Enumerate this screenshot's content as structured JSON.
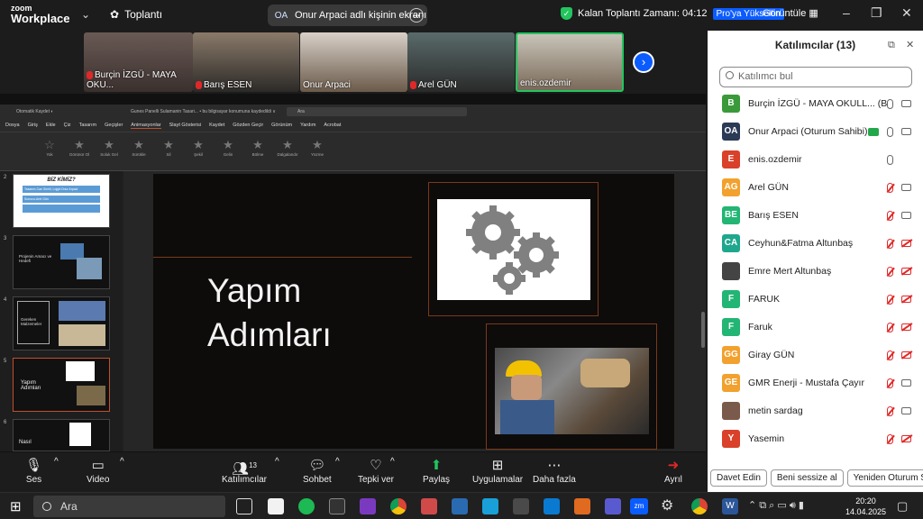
{
  "app": {
    "logo_line1": "zoom",
    "logo_line2": "Workplace",
    "meeting_label": "Toplantı",
    "share_badge": "OA",
    "share_text": "Onur Arpaci adlı kişinin ekranı",
    "timer_text": "Kalan Toplantı Zamanı: 04:12",
    "upgrade_label": "Pro'ya Yükseltin",
    "view_label": "Görüntüle"
  },
  "tiles": [
    {
      "name": "Burçin İZGÜ - MAYA OKU..."
    },
    {
      "name": "Barış ESEN"
    },
    {
      "name": "Onur Arpaci"
    },
    {
      "name": "Arel GÜN"
    },
    {
      "name": "enis.ozdemir"
    }
  ],
  "ppt": {
    "doc_title": "Gunes Panelli Sulamanin Tasari... • bu bilgisayar konumuna kaydedildi ∨",
    "search": "Ara",
    "menu": [
      "Dosya",
      "Giriş",
      "Ekle",
      "Çiz",
      "Tasarım",
      "Geçişler",
      "Animasyonlar",
      "Slayt Gösterisi",
      "Kaydet",
      "Gözden Geçir",
      "Görünüm",
      "Yardım",
      "Acrobat"
    ],
    "ribbon": [
      "Yok",
      "Görünür Ol",
      "Soluk Gel",
      "Sürükle",
      "Sil",
      "Şekil",
      "Gelin",
      "Bölme",
      "Dalgalandır",
      "Yüzme"
    ],
    "slide_title_1": "Yapım",
    "slide_title_2": "Adımları",
    "thumb2_title": "BİZ KİMİZ?",
    "thumb2_a": "Tasarım-Can Sinirli, Lojgit:Onur Arpaci",
    "thumb2_b": "Sunucu-Arel Gün",
    "thumb3_title": "Projenin Amacı ve Hedefi",
    "thumb4_title": "Gereken Malzemeler",
    "thumb5_title": "Yapım Adımları",
    "thumb6_title": "Nasıl"
  },
  "panel": {
    "title": "Katılımcılar (13)",
    "search_placeholder": "Katılımcı bul",
    "participants": [
      {
        "initials": "B",
        "name": "Burçin İZGÜ - MAYA OKULL... (Ben)",
        "color": "#3a9a3a",
        "mic": "on",
        "cam": "on"
      },
      {
        "initials": "OA",
        "name": "Onur Arpaci (Oturum Sahibi)",
        "color": "#2b3a55",
        "mic": "on",
        "cam": "on",
        "sharing": true
      },
      {
        "initials": "E",
        "name": "enis.ozdemir",
        "color": "#d9412a",
        "mic": "on",
        "cam": "none"
      },
      {
        "initials": "AG",
        "name": "Arel GÜN",
        "color": "#f2a12e",
        "mic": "off",
        "cam": "on"
      },
      {
        "initials": "BE",
        "name": "Barış ESEN",
        "color": "#22b573",
        "mic": "off",
        "cam": "on"
      },
      {
        "initials": "CA",
        "name": "Ceyhun&Fatma Altunbaş",
        "color": "#1fa78e",
        "mic": "off",
        "cam": "off"
      },
      {
        "initials": "",
        "name": "Emre Mert Altunbaş",
        "color": "#444",
        "mic": "off",
        "cam": "off"
      },
      {
        "initials": "F",
        "name": "FARUK",
        "color": "#22b573",
        "mic": "off",
        "cam": "off"
      },
      {
        "initials": "F",
        "name": "Faruk",
        "color": "#22b573",
        "mic": "off",
        "cam": "off"
      },
      {
        "initials": "GG",
        "name": "Giray GÜN",
        "color": "#f2a12e",
        "mic": "off",
        "cam": "off"
      },
      {
        "initials": "GE",
        "name": "GMR Enerji - Mustafa Çayır",
        "color": "#f2a12e",
        "mic": "off",
        "cam": "on"
      },
      {
        "initials": "",
        "name": "metin sardag",
        "color": "#7a5a4a",
        "mic": "off",
        "cam": "on"
      },
      {
        "initials": "Y",
        "name": "Yasemin",
        "color": "#d9412a",
        "mic": "off",
        "cam": "off"
      }
    ],
    "footer": [
      "Davet Edin",
      "Beni sessize al",
      "Yeniden Oturum Sah"
    ]
  },
  "toolbar": {
    "audio": "Ses",
    "video": "Video",
    "participants": "Katılımcılar",
    "participants_count": "13",
    "chat": "Sohbet",
    "react": "Tepki ver",
    "share": "Paylaş",
    "apps": "Uygulamalar",
    "more": "Daha fazla",
    "leave": "Ayrıl"
  },
  "taskbar": {
    "search": "Ara",
    "time": "20:20",
    "date": "14.04.2025"
  }
}
